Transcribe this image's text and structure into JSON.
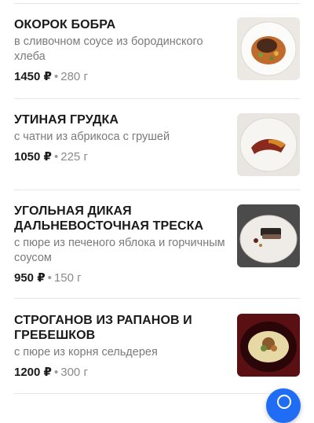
{
  "menu": {
    "items": [
      {
        "title": "ОКОРОК БОБРА",
        "description": "в сливочном соусе из бородинского хлеба",
        "price": "1450 ₽",
        "weight": "280 г",
        "image_icon": "dish-photo-icon"
      },
      {
        "title": "УТИНАЯ ГРУДКА",
        "description": "с чатни из абрикоса с грушей",
        "price": "1050 ₽",
        "weight": "225 г",
        "image_icon": "dish-photo-icon"
      },
      {
        "title": "УГОЛЬНАЯ ДИКАЯ ДАЛЬНЕВОСТОЧНАЯ ТРЕСКА",
        "description": "с пюре из печеного яблока и горчичным соусом",
        "price": "950 ₽",
        "weight": "150 г",
        "image_icon": "dish-photo-icon"
      },
      {
        "title": "СТРОГАНОВ ИЗ РАПАНОВ И ГРЕБЕШКОВ",
        "description": "с пюре из корня сельдерея",
        "price": "1200 ₽",
        "weight": "300 г",
        "image_icon": "dish-photo-icon"
      }
    ],
    "separator": "•"
  },
  "colors": {
    "accent": "#1f6cf5",
    "muted_text": "#7a7a7a",
    "divider": "#e6e6e6"
  }
}
